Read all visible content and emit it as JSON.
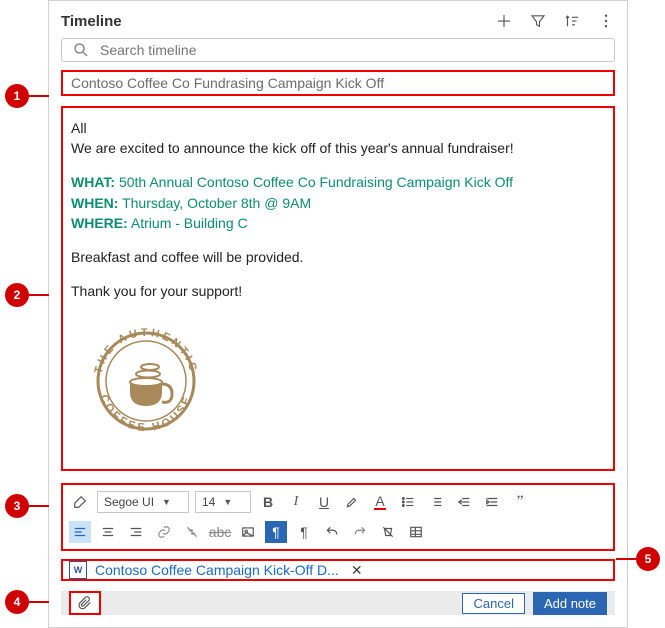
{
  "header": {
    "title": "Timeline"
  },
  "search": {
    "placeholder": "Search timeline"
  },
  "note": {
    "title": "Contoso Coffee Co Fundrasing Campaign Kick Off",
    "greeting": "All",
    "intro": "We are excited to announce the kick off of this year's annual fundraiser!",
    "what_label": "WHAT:",
    "what_value": "50th Annual Contoso Coffee Co Fundraising Campaign Kick Off",
    "when_label": "WHEN:",
    "when_value": "Thursday, October 8th @ 9AM",
    "where_label": "WHERE:",
    "where_value": "Atrium - Building C",
    "footer1": "Breakfast and coffee will be provided.",
    "footer2": "Thank you for your support!",
    "logo_top": "THE AUTHENTIC",
    "logo_bottom": "COFFEE HOUSE"
  },
  "toolbar": {
    "font": "Segoe UI",
    "size": "14"
  },
  "attachment": {
    "name": "Contoso Coffee Campaign Kick-Off D..."
  },
  "footer": {
    "cancel": "Cancel",
    "add": "Add note"
  },
  "callouts": {
    "c1": "1",
    "c2": "2",
    "c3": "3",
    "c4": "4",
    "c5": "5"
  }
}
